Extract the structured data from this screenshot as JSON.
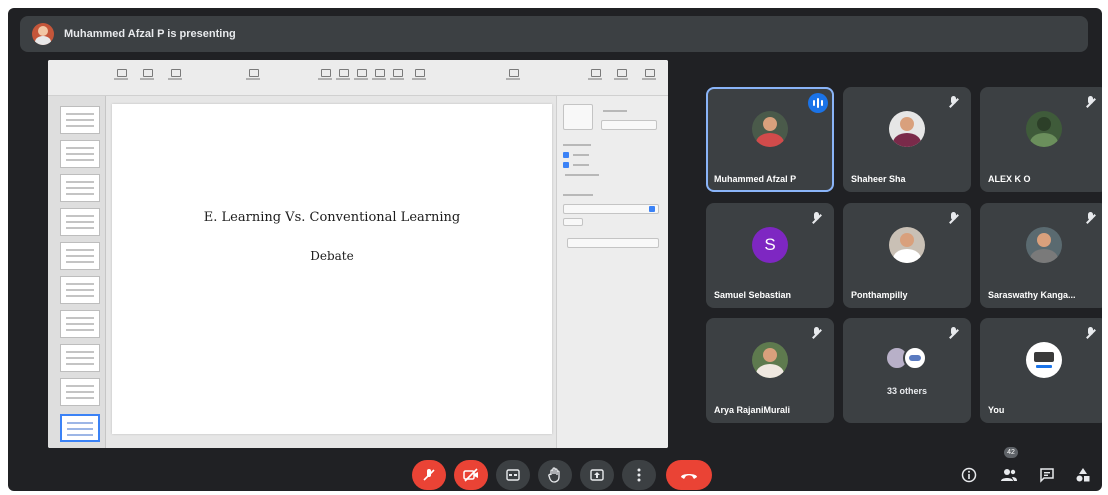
{
  "presenting_banner": {
    "text": "Muhammed Afzal P is presenting"
  },
  "slide": {
    "title": "E. Learning Vs. Conventional Learning",
    "subtitle": "Debate"
  },
  "participants": [
    {
      "name": "Muhammed Afzal P",
      "speaking": true
    },
    {
      "name": "Shaheer Sha",
      "muted": true
    },
    {
      "name": "ALEX K O",
      "muted": true
    },
    {
      "name": "Samuel Sebastian",
      "avatar_letter": "S",
      "avatar_color": "#7e27c2",
      "muted": true
    },
    {
      "name": "Ponthampilly",
      "muted": true
    },
    {
      "name": "Saraswathy Kanga...",
      "muted": true
    },
    {
      "name": "Arya RajaniMurali",
      "muted": true
    },
    {
      "others_label": "33 others",
      "muted": true
    },
    {
      "name": "You",
      "muted": true
    }
  ],
  "controls": {
    "mic": "mic-off-icon",
    "camera": "camera-off-icon",
    "captions": "captions-icon",
    "raise_hand": "hand-icon",
    "present": "present-icon",
    "more": "more-vert-icon",
    "leave": "hang-up-icon",
    "leave_color": "#ea4335"
  },
  "right_controls": {
    "people_count": "42"
  },
  "colors": {
    "background": "#202124",
    "tile": "#3c4043",
    "accent": "#1a73e8"
  }
}
